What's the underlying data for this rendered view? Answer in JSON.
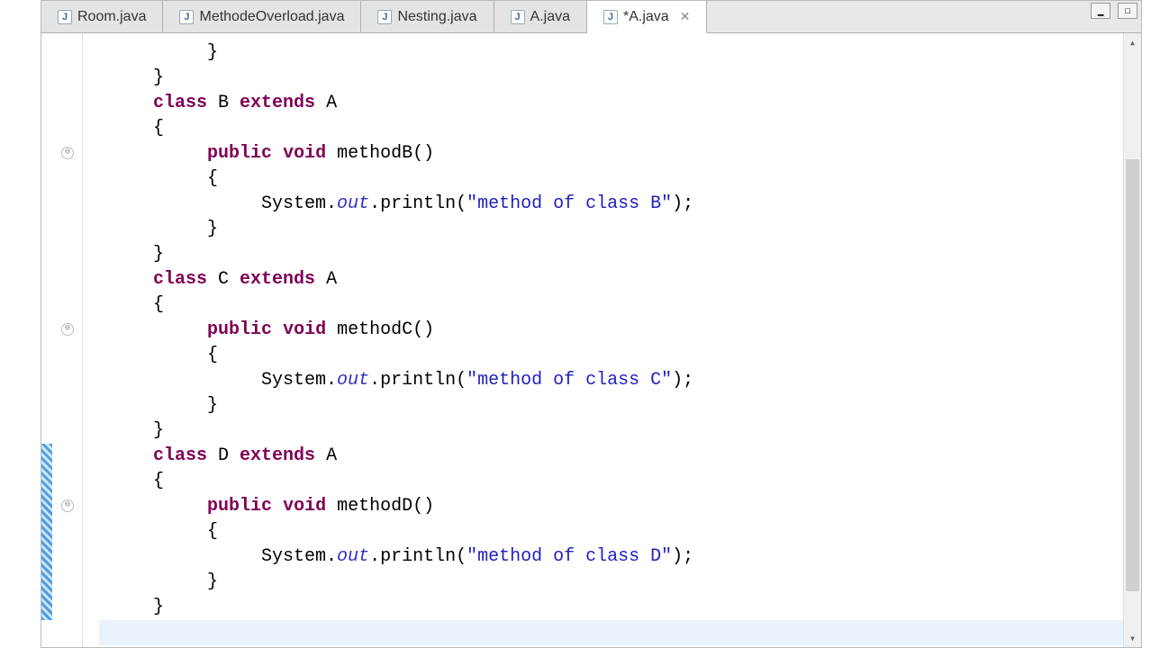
{
  "tabs": [
    {
      "label": "Room.java",
      "active": false
    },
    {
      "label": "MethodeOverload.java",
      "active": false
    },
    {
      "label": "Nesting.java",
      "active": false
    },
    {
      "label": "A.java",
      "active": false
    },
    {
      "label": "*A.java",
      "active": true
    }
  ],
  "code": {
    "lines": [
      {
        "indent": 2,
        "tokens": [
          {
            "t": "}",
            "c": "plain"
          }
        ]
      },
      {
        "indent": 1,
        "tokens": [
          {
            "t": "}",
            "c": "plain"
          }
        ]
      },
      {
        "indent": 1,
        "tokens": [
          {
            "t": "class",
            "c": "kw"
          },
          {
            "t": " B ",
            "c": "plain"
          },
          {
            "t": "extends",
            "c": "kw"
          },
          {
            "t": " A",
            "c": "plain"
          }
        ]
      },
      {
        "indent": 1,
        "tokens": [
          {
            "t": "{",
            "c": "plain"
          }
        ]
      },
      {
        "indent": 2,
        "fold": true,
        "tokens": [
          {
            "t": "public",
            "c": "kw"
          },
          {
            "t": " ",
            "c": "plain"
          },
          {
            "t": "void",
            "c": "kw"
          },
          {
            "t": " methodB()",
            "c": "plain"
          }
        ]
      },
      {
        "indent": 2,
        "tokens": [
          {
            "t": "{",
            "c": "plain"
          }
        ]
      },
      {
        "indent": 3,
        "tokens": [
          {
            "t": "System.",
            "c": "plain"
          },
          {
            "t": "out",
            "c": "field"
          },
          {
            "t": ".println(",
            "c": "plain"
          },
          {
            "t": "\"method of class B\"",
            "c": "str"
          },
          {
            "t": ");",
            "c": "plain"
          }
        ]
      },
      {
        "indent": 2,
        "tokens": [
          {
            "t": "}",
            "c": "plain"
          }
        ]
      },
      {
        "indent": 1,
        "tokens": [
          {
            "t": "}",
            "c": "plain"
          }
        ]
      },
      {
        "indent": 1,
        "tokens": [
          {
            "t": "class",
            "c": "kw"
          },
          {
            "t": " C ",
            "c": "plain"
          },
          {
            "t": "extends",
            "c": "kw"
          },
          {
            "t": " A",
            "c": "plain"
          }
        ]
      },
      {
        "indent": 1,
        "tokens": [
          {
            "t": "{",
            "c": "plain"
          }
        ]
      },
      {
        "indent": 2,
        "fold": true,
        "tokens": [
          {
            "t": "public",
            "c": "kw"
          },
          {
            "t": " ",
            "c": "plain"
          },
          {
            "t": "void",
            "c": "kw"
          },
          {
            "t": " methodC()",
            "c": "plain"
          }
        ]
      },
      {
        "indent": 2,
        "tokens": [
          {
            "t": "{",
            "c": "plain"
          }
        ]
      },
      {
        "indent": 3,
        "tokens": [
          {
            "t": "System.",
            "c": "plain"
          },
          {
            "t": "out",
            "c": "field"
          },
          {
            "t": ".println(",
            "c": "plain"
          },
          {
            "t": "\"method of class C\"",
            "c": "str"
          },
          {
            "t": ");",
            "c": "plain"
          }
        ]
      },
      {
        "indent": 2,
        "tokens": [
          {
            "t": "}",
            "c": "plain"
          }
        ]
      },
      {
        "indent": 1,
        "tokens": [
          {
            "t": "}",
            "c": "plain"
          }
        ]
      },
      {
        "indent": 1,
        "changed": true,
        "tokens": [
          {
            "t": "class",
            "c": "kw"
          },
          {
            "t": " D ",
            "c": "plain"
          },
          {
            "t": "extends",
            "c": "kw"
          },
          {
            "t": " A",
            "c": "plain"
          }
        ]
      },
      {
        "indent": 1,
        "changed": true,
        "tokens": [
          {
            "t": "{",
            "c": "plain"
          }
        ]
      },
      {
        "indent": 2,
        "changed": true,
        "fold": true,
        "tokens": [
          {
            "t": "public",
            "c": "kw"
          },
          {
            "t": " ",
            "c": "plain"
          },
          {
            "t": "void",
            "c": "kw"
          },
          {
            "t": " methodD()",
            "c": "plain"
          }
        ]
      },
      {
        "indent": 2,
        "changed": true,
        "tokens": [
          {
            "t": "{",
            "c": "plain"
          }
        ]
      },
      {
        "indent": 3,
        "changed": true,
        "tokens": [
          {
            "t": "System.",
            "c": "plain"
          },
          {
            "t": "out",
            "c": "field"
          },
          {
            "t": ".println(",
            "c": "plain"
          },
          {
            "t": "\"method of class D\"",
            "c": "str"
          },
          {
            "t": ");",
            "c": "plain"
          }
        ]
      },
      {
        "indent": 2,
        "changed": true,
        "tokens": [
          {
            "t": "}",
            "c": "plain"
          }
        ]
      },
      {
        "indent": 1,
        "changed": true,
        "tokens": [
          {
            "t": "}",
            "c": "plain"
          }
        ]
      },
      {
        "indent": 1,
        "current": true,
        "tokens": [
          {
            "t": "",
            "c": "plain"
          }
        ]
      }
    ]
  },
  "icons": {
    "java_letter": "J",
    "close": "✕",
    "minimize": "▁",
    "maximize": "☐",
    "fold": "⊖",
    "arrow_up": "▴",
    "arrow_down": "▾"
  }
}
